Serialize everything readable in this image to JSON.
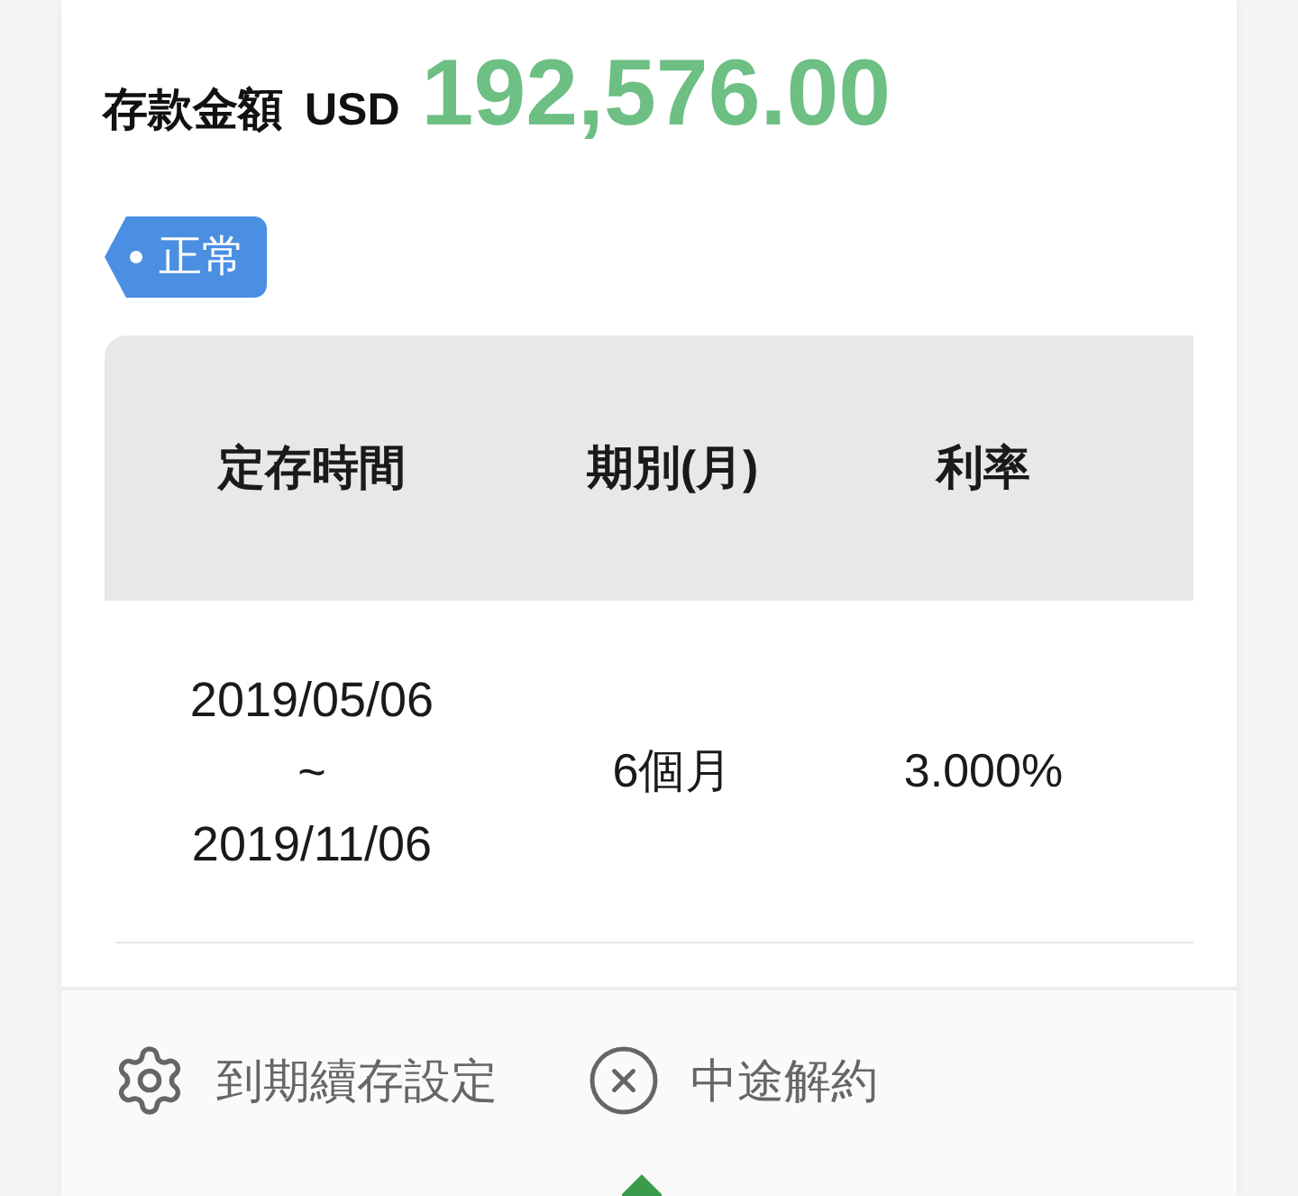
{
  "summary": {
    "label": "存款金額",
    "currency": "USD",
    "amount": "192,576.00"
  },
  "status_tag": {
    "label": "正常"
  },
  "table": {
    "columns": [
      "定存時間",
      "期別(月)",
      "利率"
    ],
    "rows": [
      {
        "period_start": "2019/05/06",
        "separator": "~",
        "period_end": "2019/11/06",
        "term": "6個月",
        "rate": "3.000%"
      }
    ]
  },
  "actions": [
    {
      "kind": "settings",
      "label": "到期續存設定"
    },
    {
      "kind": "cancel",
      "label": "中途解約"
    }
  ]
}
